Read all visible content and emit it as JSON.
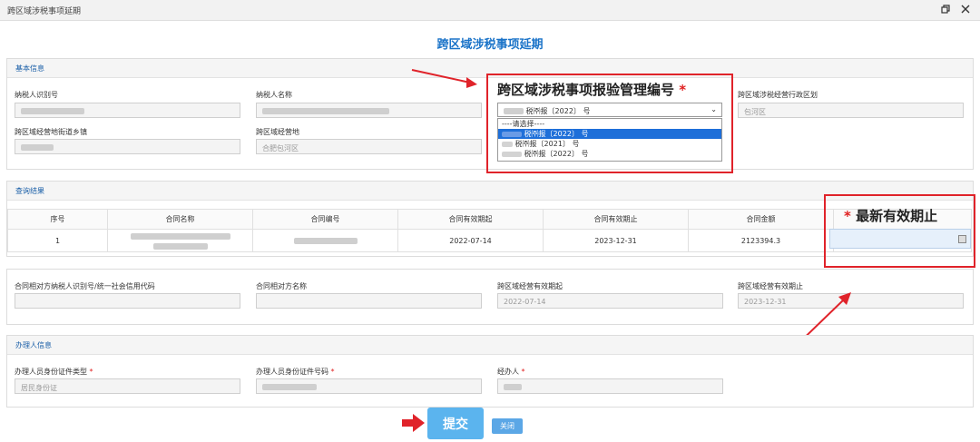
{
  "window": {
    "title": "跨区域涉税事项延期"
  },
  "page_title": "跨区域涉税事项延期",
  "basic": {
    "section_title": "基本信息",
    "taxpayer_id_label": "纳税人识别号",
    "taxpayer_name_label": "纳税人名称",
    "code_label": "跨区域涉税事项报验管理编号",
    "region_label": "跨区域涉税经营行政区划",
    "region_value": "包河区",
    "street_label": "跨区域经营地街道乡镇",
    "place_label": "跨区域经营地",
    "place_value": "合肥包河区",
    "select_value": "税㈜报〔2022〕  号",
    "options": [
      {
        "label": "----请选择----"
      },
      {
        "label": "税㈜报〔2022〕  号"
      },
      {
        "label": "税㈜报〔2021〕  号"
      },
      {
        "label": "税㈜报〔2022〕  号"
      }
    ]
  },
  "callouts": {
    "code": "跨区域涉税事项报验管理编号",
    "latest_end": "最新有效期止",
    "star": "*"
  },
  "results": {
    "section_title": "查询结果",
    "columns": [
      "序号",
      "合同名称",
      "合同编号",
      "合同有效期起",
      "合同有效期止",
      "合同金额"
    ],
    "row": {
      "no": "1",
      "start": "2022-07-14",
      "end": "2023-12-31",
      "amount": "2123394.3"
    }
  },
  "contract": {
    "counterparty_id_label": "合同相对方纳税人识别号/统一社会信用代码",
    "counterparty_name_label": "合同相对方名称",
    "valid_start_label": "跨区域经营有效期起",
    "valid_start_value": "2022-07-14",
    "valid_end_label": "跨区域经营有效期止",
    "valid_end_value": "2023-12-31"
  },
  "handler": {
    "section_title": "办理人信息",
    "id_type_label": "办理人员身份证件类型",
    "id_type_value": "居民身份证",
    "id_no_label": "办理人员身份证件号码",
    "agent_label": "经办人"
  },
  "buttons": {
    "submit": "提交",
    "close": "关闭"
  },
  "colors": {
    "accent": "#1a73c8",
    "annotation": "#e0232a",
    "button": "#5bb4ee"
  }
}
